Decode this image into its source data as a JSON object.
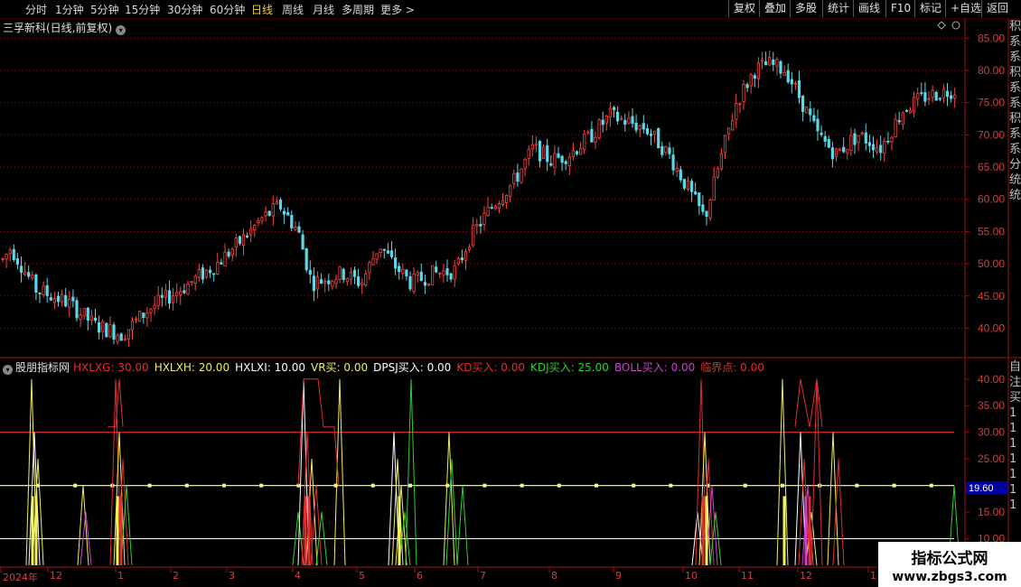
{
  "toolbar": {
    "periods": [
      "分时",
      "1分钟",
      "5分钟",
      "15分钟",
      "30分钟",
      "60分钟",
      "日线",
      "周线",
      "月线",
      "多周期",
      "更多 >"
    ],
    "active_period": "日线",
    "actions": [
      "复权",
      "叠加",
      "多股",
      "统计",
      "画线",
      "F10",
      "标记",
      "+自选",
      "返回"
    ]
  },
  "main_panel": {
    "title": "三孚新科(日线,前复权)",
    "price_ticks": [
      "85.00",
      "80.00",
      "75.00",
      "70.00",
      "65.00",
      "60.00",
      "55.00",
      "50.00",
      "45.00",
      "40.00"
    ],
    "price_range": [
      36,
      87
    ],
    "right_side_text": "积系系积系系积系系分统统"
  },
  "indicator_panel": {
    "name": "股朋指标网",
    "values": [
      {
        "label": "HXLXG: 30.00",
        "color": "#e03030"
      },
      {
        "label": "HXLXH: 20.00",
        "color": "#f0f060"
      },
      {
        "label": "HXLXI: 10.00",
        "color": "#ffffff"
      },
      {
        "label": "VR买: 0.00",
        "color": "#f0f060"
      },
      {
        "label": "DPSJ买入: 0.00",
        "color": "#ffffff"
      },
      {
        "label": "KD买入: 0.00",
        "color": "#e03030"
      },
      {
        "label": "KDJ买入: 25.00",
        "color": "#30d030"
      },
      {
        "label": "BOLL买入: 0.00",
        "color": "#d040d0"
      },
      {
        "label": "临界点: 0.00",
        "color": "#e03030"
      }
    ],
    "ticks": [
      "40.00",
      "35.00",
      "30.00",
      "25.00",
      "20.00",
      "15.00",
      "10.00"
    ],
    "range": [
      5,
      42
    ],
    "current_value": "19.60",
    "right_side_text": "自注买1111111"
  },
  "time_axis": {
    "labels": [
      "2024年",
      "12",
      "1",
      "2",
      "3",
      "4",
      "5",
      "6",
      "7",
      "8",
      "9",
      "10",
      "11",
      "12",
      "1"
    ]
  },
  "watermark": {
    "line1": "指标公式网",
    "line2": "www.zbgs3.com"
  },
  "colors": {
    "up": "#ff4444",
    "down": "#5ad8e8",
    "grid": "#8a1010",
    "axis_text": "#d04040"
  }
}
